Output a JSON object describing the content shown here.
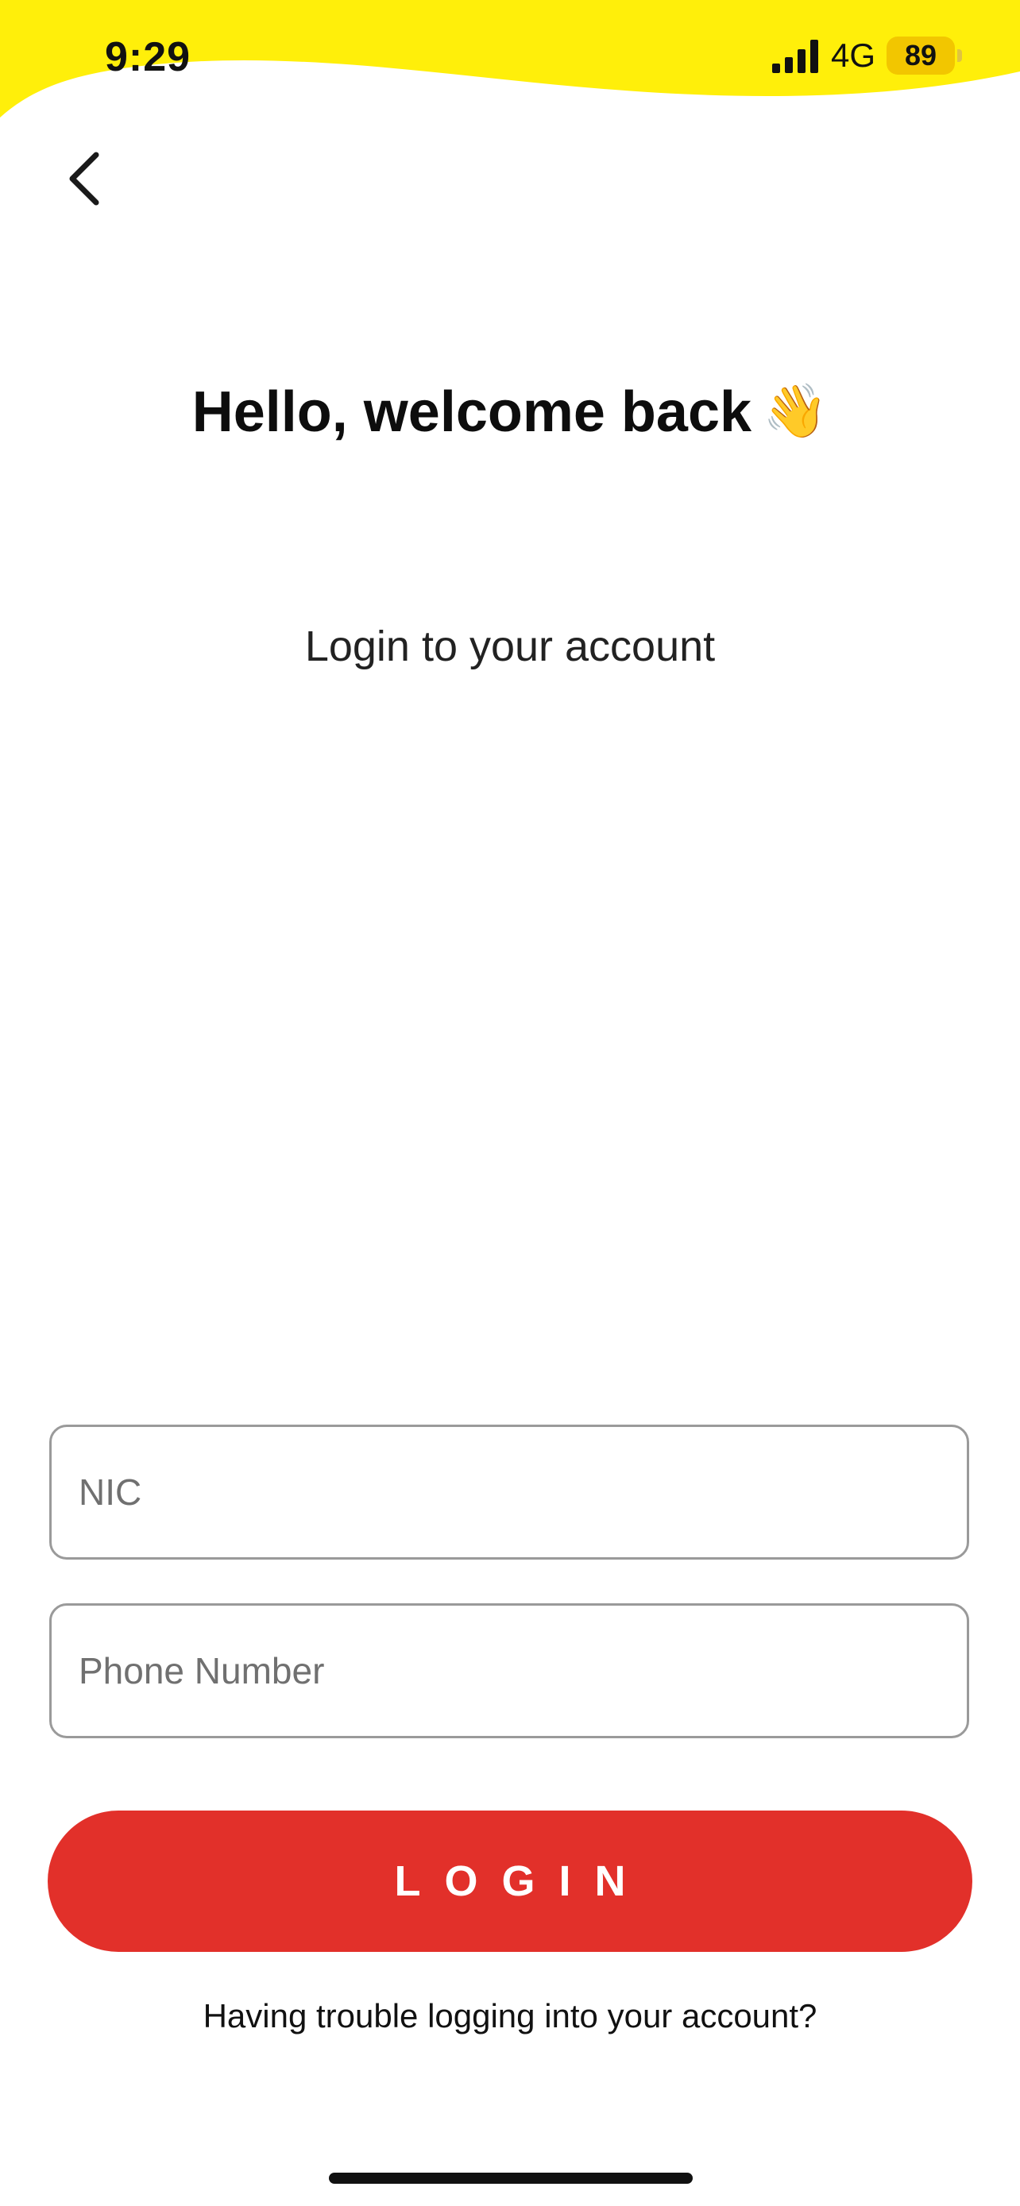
{
  "status_bar": {
    "time": "9:29",
    "network": "4G",
    "battery": "89",
    "accent_color": "#FFEF0A"
  },
  "header": {
    "back_icon": "chevron-left-icon"
  },
  "main": {
    "title": "Hello, welcome back",
    "title_emoji": "👋",
    "subtitle": "Login to your account"
  },
  "form": {
    "nic_placeholder": "NIC",
    "nic_value": "",
    "phone_placeholder": "Phone Number",
    "phone_value": "",
    "login_label": "LOGIN",
    "login_color": "#E2302A",
    "trouble_text": "Having trouble logging into your account?"
  }
}
